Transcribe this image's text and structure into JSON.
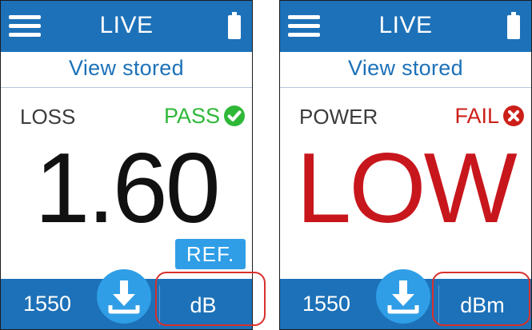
{
  "panels": [
    {
      "header": {
        "mode_label": "LIVE"
      },
      "view_stored_label": "View stored",
      "measurement_label": "LOSS",
      "status_label": "PASS",
      "main_value": "1.60",
      "ref_button_label": "REF.",
      "footer": {
        "wavelength": "1550",
        "unit_label": "dB"
      }
    },
    {
      "header": {
        "mode_label": "LIVE"
      },
      "view_stored_label": "View stored",
      "measurement_label": "POWER",
      "status_label": "FAIL",
      "main_value": "LOW",
      "footer": {
        "wavelength": "1550",
        "unit_label": "dBm"
      }
    }
  ],
  "icons": {
    "menu": "menu-icon",
    "battery": "battery-icon",
    "pass": "check-circle-icon",
    "fail": "x-circle-icon",
    "save": "download-icon"
  },
  "colors": {
    "bar_blue": "#1d71b8",
    "light_blue": "#2f9ee6",
    "pass_green": "#2fb838",
    "fail_red": "#cc1f1a",
    "highlight_red": "#d9302b"
  }
}
